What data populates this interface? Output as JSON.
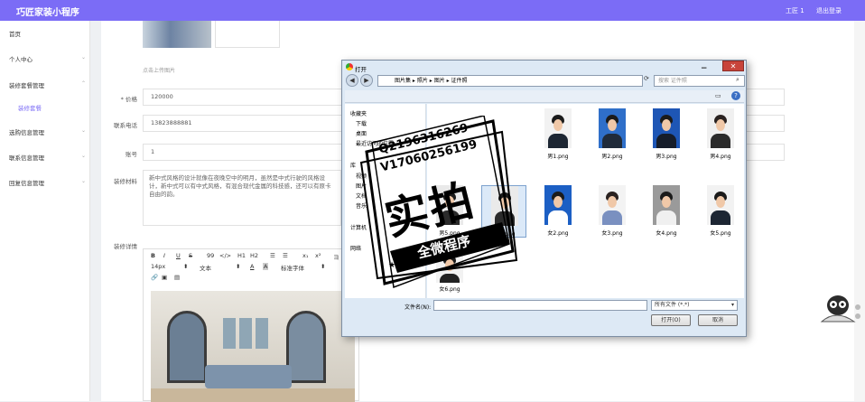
{
  "header": {
    "title": "巧匠家装小程序",
    "user": "工匠 1",
    "logout": "退出登录"
  },
  "sidebar": {
    "items": [
      {
        "label": "首页"
      },
      {
        "label": "个人中心"
      },
      {
        "label": "装修套餐管理"
      },
      {
        "label": "装修套餐"
      },
      {
        "label": "选购信息管理"
      },
      {
        "label": "联系信息管理"
      },
      {
        "label": "回复信息管理"
      }
    ]
  },
  "form": {
    "upload_hint": "点击上传图片",
    "price_label": "* 价格",
    "price_value": "120000",
    "phone_label": "联系电话",
    "phone_value": "13823888881",
    "account_label": "账号",
    "account_value": "1",
    "material_label": "装修材料",
    "material_value": "新中式风格的设计就像在夜晚空中的明月，虽然是中式行驶的风格设计，新中式可以有中式风格，有混合现代金属的科技感，还可以有原卡自由的韵。",
    "detail_label": "装修详情"
  },
  "editor": {
    "toolbar1": [
      "B",
      "I",
      "U",
      "S",
      "99",
      "</>",
      "H1",
      "H2",
      "☰",
      "☰",
      "x₁",
      "x²",
      "ヨ"
    ],
    "font_size": "14px",
    "text_type": "文本",
    "font_family": "标准字体"
  },
  "dialog": {
    "title": "打开",
    "breadcrumb": [
      "图片集",
      "照片",
      "图片",
      "证件照"
    ],
    "search_placeholder": "搜索 证件照",
    "tree": [
      "收藏夹",
      "下载",
      "桌面",
      "最近访问的位置",
      "库",
      "视频",
      "图片",
      "文档",
      "音乐",
      "计算机",
      "网络"
    ],
    "files": [
      {
        "name": "男1.png",
        "bg": "#f2f2f2",
        "body": "#1d2633",
        "hair": "#1b1b1b"
      },
      {
        "name": "男2.png",
        "bg": "#2f6fc9",
        "body": "#202b3a",
        "hair": "#1b1b1b"
      },
      {
        "name": "男3.png",
        "bg": "#1e56b5",
        "body": "#161d2a",
        "hair": "#1b1b1b"
      },
      {
        "name": "男4.png",
        "bg": "#f0f0f0",
        "body": "#2b2b2b",
        "hair": "#2a2220"
      },
      {
        "name": "女2.png",
        "bg": "#1c5fc4",
        "body": "#ffffff",
        "hair": "#1b1b1b"
      },
      {
        "name": "女3.png",
        "bg": "#f3f3f3",
        "body": "#7a90c0",
        "hair": "#2a2220"
      },
      {
        "name": "女4.png",
        "bg": "#9a9a9a",
        "body": "#f0f0f0",
        "hair": "#1b1b1b"
      },
      {
        "name": "女5.png",
        "bg": "#f2f2f2",
        "body": "#1d2633",
        "hair": "#1b1b1b"
      },
      {
        "name": "男5.png",
        "bg": "#e9e9e9",
        "body": "#2b2b2b",
        "hair": "#1b1b1b"
      },
      {
        "name": "女1.png",
        "bg": "#eaeaea",
        "body": "#2b2b2b",
        "hair": "#1b1b1b"
      },
      {
        "name": "女6.png",
        "bg": "#f2f2f2",
        "body": "#222",
        "hair": "#1b1b1b"
      }
    ],
    "filename_label": "文件名(N):",
    "filetype": "所有文件 (*.*)",
    "open": "打开(O)",
    "cancel": "取消"
  },
  "watermark": {
    "line1": "Q2196316269",
    "line2": "V17060256199",
    "big": "实拍",
    "banner": "全微程序"
  },
  "colors": {
    "accent": "#7b6cf6"
  }
}
